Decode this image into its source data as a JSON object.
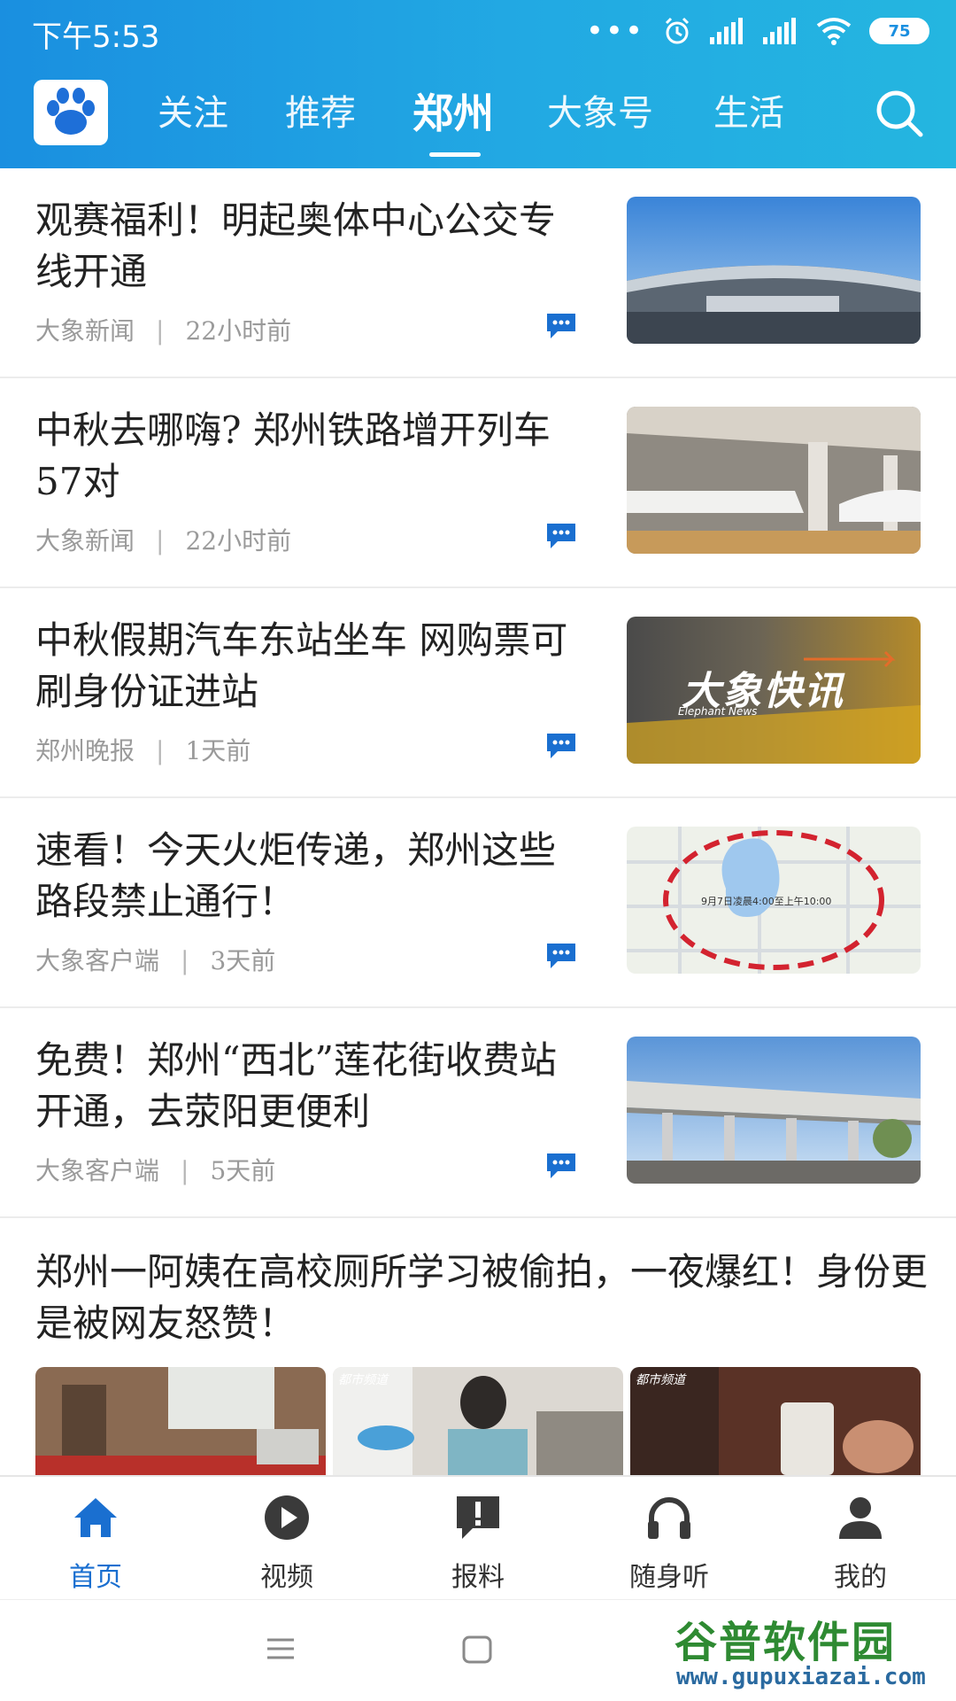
{
  "status_bar": {
    "time": "下午5:53",
    "battery": "75"
  },
  "nav": {
    "tabs": [
      "关注",
      "推荐",
      "郑州",
      "大象号",
      "生活"
    ],
    "active_tab": "郑州"
  },
  "feed": [
    {
      "title": "观赛福利！明起奥体中心公交专线开通",
      "source": "大象新闻",
      "time": "22小时前",
      "thumb": "stadium"
    },
    {
      "title": "中秋去哪嗨? 郑州铁路增开列车57对",
      "source": "大象新闻",
      "time": "22小时前",
      "thumb": "train"
    },
    {
      "title": "中秋假期汽车东站坐车 网购票可刷身份证进站",
      "source": "郑州晚报",
      "time": "1天前",
      "thumb": "quicknews",
      "thumb_text": "大象快讯",
      "thumb_sub": "Elephant News"
    },
    {
      "title": "速看！今天火炬传递，郑州这些路段禁止通行！",
      "source": "大象客户端",
      "time": "3天前",
      "thumb": "map",
      "thumb_text": "9月7日凌晨4:00至上午10:00"
    },
    {
      "title": "免费！郑州“西北”莲花街收费站开通，去荥阳更便利",
      "source": "大象客户端",
      "time": "5天前",
      "thumb": "tollgate"
    }
  ],
  "wide_item": {
    "title": "郑州一阿姨在高校厕所学习被偷拍，一夜爆红！身份更是被网友怒赞！",
    "thumb_tags": [
      "都市频道",
      "都市频道"
    ]
  },
  "bottom_nav": [
    {
      "label": "首页",
      "icon": "home-icon",
      "active": true
    },
    {
      "label": "视频",
      "icon": "play-icon",
      "active": false
    },
    {
      "label": "报料",
      "icon": "report-icon",
      "active": false
    },
    {
      "label": "随身听",
      "icon": "headphones-icon",
      "active": false
    },
    {
      "label": "我的",
      "icon": "user-icon",
      "active": false
    }
  ],
  "watermark": {
    "title": "谷普软件园",
    "url": "www.gupuxiazai.com"
  },
  "colors": {
    "header_start": "#1a8fe0",
    "header_end": "#24b6e0",
    "accent": "#1a6fd0"
  }
}
